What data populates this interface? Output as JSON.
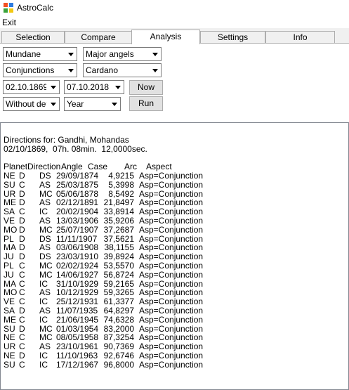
{
  "window": {
    "title": "AstroCalc"
  },
  "menu": {
    "exit": "Exit"
  },
  "tabs": [
    {
      "label": "Selection",
      "active": false
    },
    {
      "label": "Compare",
      "active": false
    },
    {
      "label": "Analysis",
      "active": true
    },
    {
      "label": "Settings",
      "active": false
    },
    {
      "label": "Info",
      "active": false
    }
  ],
  "controls": {
    "chart_type": "Mundane",
    "angles": "Major angels",
    "aspect_type": "Conjunctions",
    "house_system": "Cardano",
    "date_from": "02.10.1869",
    "date_to": "07.10.2018",
    "now_button": "Now",
    "detail": "Without deta",
    "period": "Year",
    "run_button": "Run"
  },
  "output": {
    "header_line1": "Directions for: Gandhi, Mohandas",
    "header_line2": "02/10/1869,  07h. 08min.  12,0000sec.",
    "columns": [
      "Planet",
      "Direction",
      "Angle",
      "Case",
      "Arc",
      "Aspect"
    ],
    "rows": [
      [
        "NE",
        "D",
        "DS",
        "29/09/1874",
        "4,9215",
        "Asp=Conjunction"
      ],
      [
        "SU",
        "C",
        "AS",
        "25/03/1875",
        "5,3998",
        "Asp=Conjunction"
      ],
      [
        "UR",
        "D",
        "MC",
        "05/06/1878",
        "8,5492",
        "Asp=Conjunction"
      ],
      [
        "ME",
        "D",
        "AS",
        "02/12/1891",
        "21,8497",
        "Asp=Conjunction"
      ],
      [
        "SA",
        "C",
        "IC",
        "20/02/1904",
        "33,8914",
        "Asp=Conjunction"
      ],
      [
        "VE",
        "D",
        "AS",
        "13/03/1906",
        "35,9206",
        "Asp=Conjunction"
      ],
      [
        "MO",
        "D",
        "MC",
        "25/07/1907",
        "37,2687",
        "Asp=Conjunction"
      ],
      [
        "PL",
        "D",
        "DS",
        "11/11/1907",
        "37,5621",
        "Asp=Conjunction"
      ],
      [
        "MA",
        "D",
        "AS",
        "03/06/1908",
        "38,1155",
        "Asp=Conjunction"
      ],
      [
        "JU",
        "D",
        "DS",
        "23/03/1910",
        "39,8924",
        "Asp=Conjunction"
      ],
      [
        "PL",
        "C",
        "MC",
        "02/02/1924",
        "53,5570",
        "Asp=Conjunction"
      ],
      [
        "JU",
        "C",
        "MC",
        "14/06/1927",
        "56,8724",
        "Asp=Conjunction"
      ],
      [
        "MA",
        "C",
        "IC",
        "31/10/1929",
        "59,2165",
        "Asp=Conjunction"
      ],
      [
        "MO",
        "C",
        "AS",
        "10/12/1929",
        "59,3265",
        "Asp=Conjunction"
      ],
      [
        "VE",
        "C",
        "IC",
        "25/12/1931",
        "61,3377",
        "Asp=Conjunction"
      ],
      [
        "SA",
        "D",
        "AS",
        "11/07/1935",
        "64,8297",
        "Asp=Conjunction"
      ],
      [
        "ME",
        "C",
        "IC",
        "21/06/1945",
        "74,6328",
        "Asp=Conjunction"
      ],
      [
        "SU",
        "D",
        "MC",
        "01/03/1954",
        "83,2000",
        "Asp=Conjunction"
      ],
      [
        "NE",
        "C",
        "MC",
        "08/05/1958",
        "87,3254",
        "Asp=Conjunction"
      ],
      [
        "UR",
        "C",
        "AS",
        "23/10/1961",
        "90,7369",
        "Asp=Conjunction"
      ],
      [
        "NE",
        "D",
        "IC",
        "11/10/1963",
        "92,6746",
        "Asp=Conjunction"
      ],
      [
        "SU",
        "C",
        "IC",
        "17/12/1967",
        "96,8000",
        "Asp=Conjunction"
      ]
    ]
  }
}
